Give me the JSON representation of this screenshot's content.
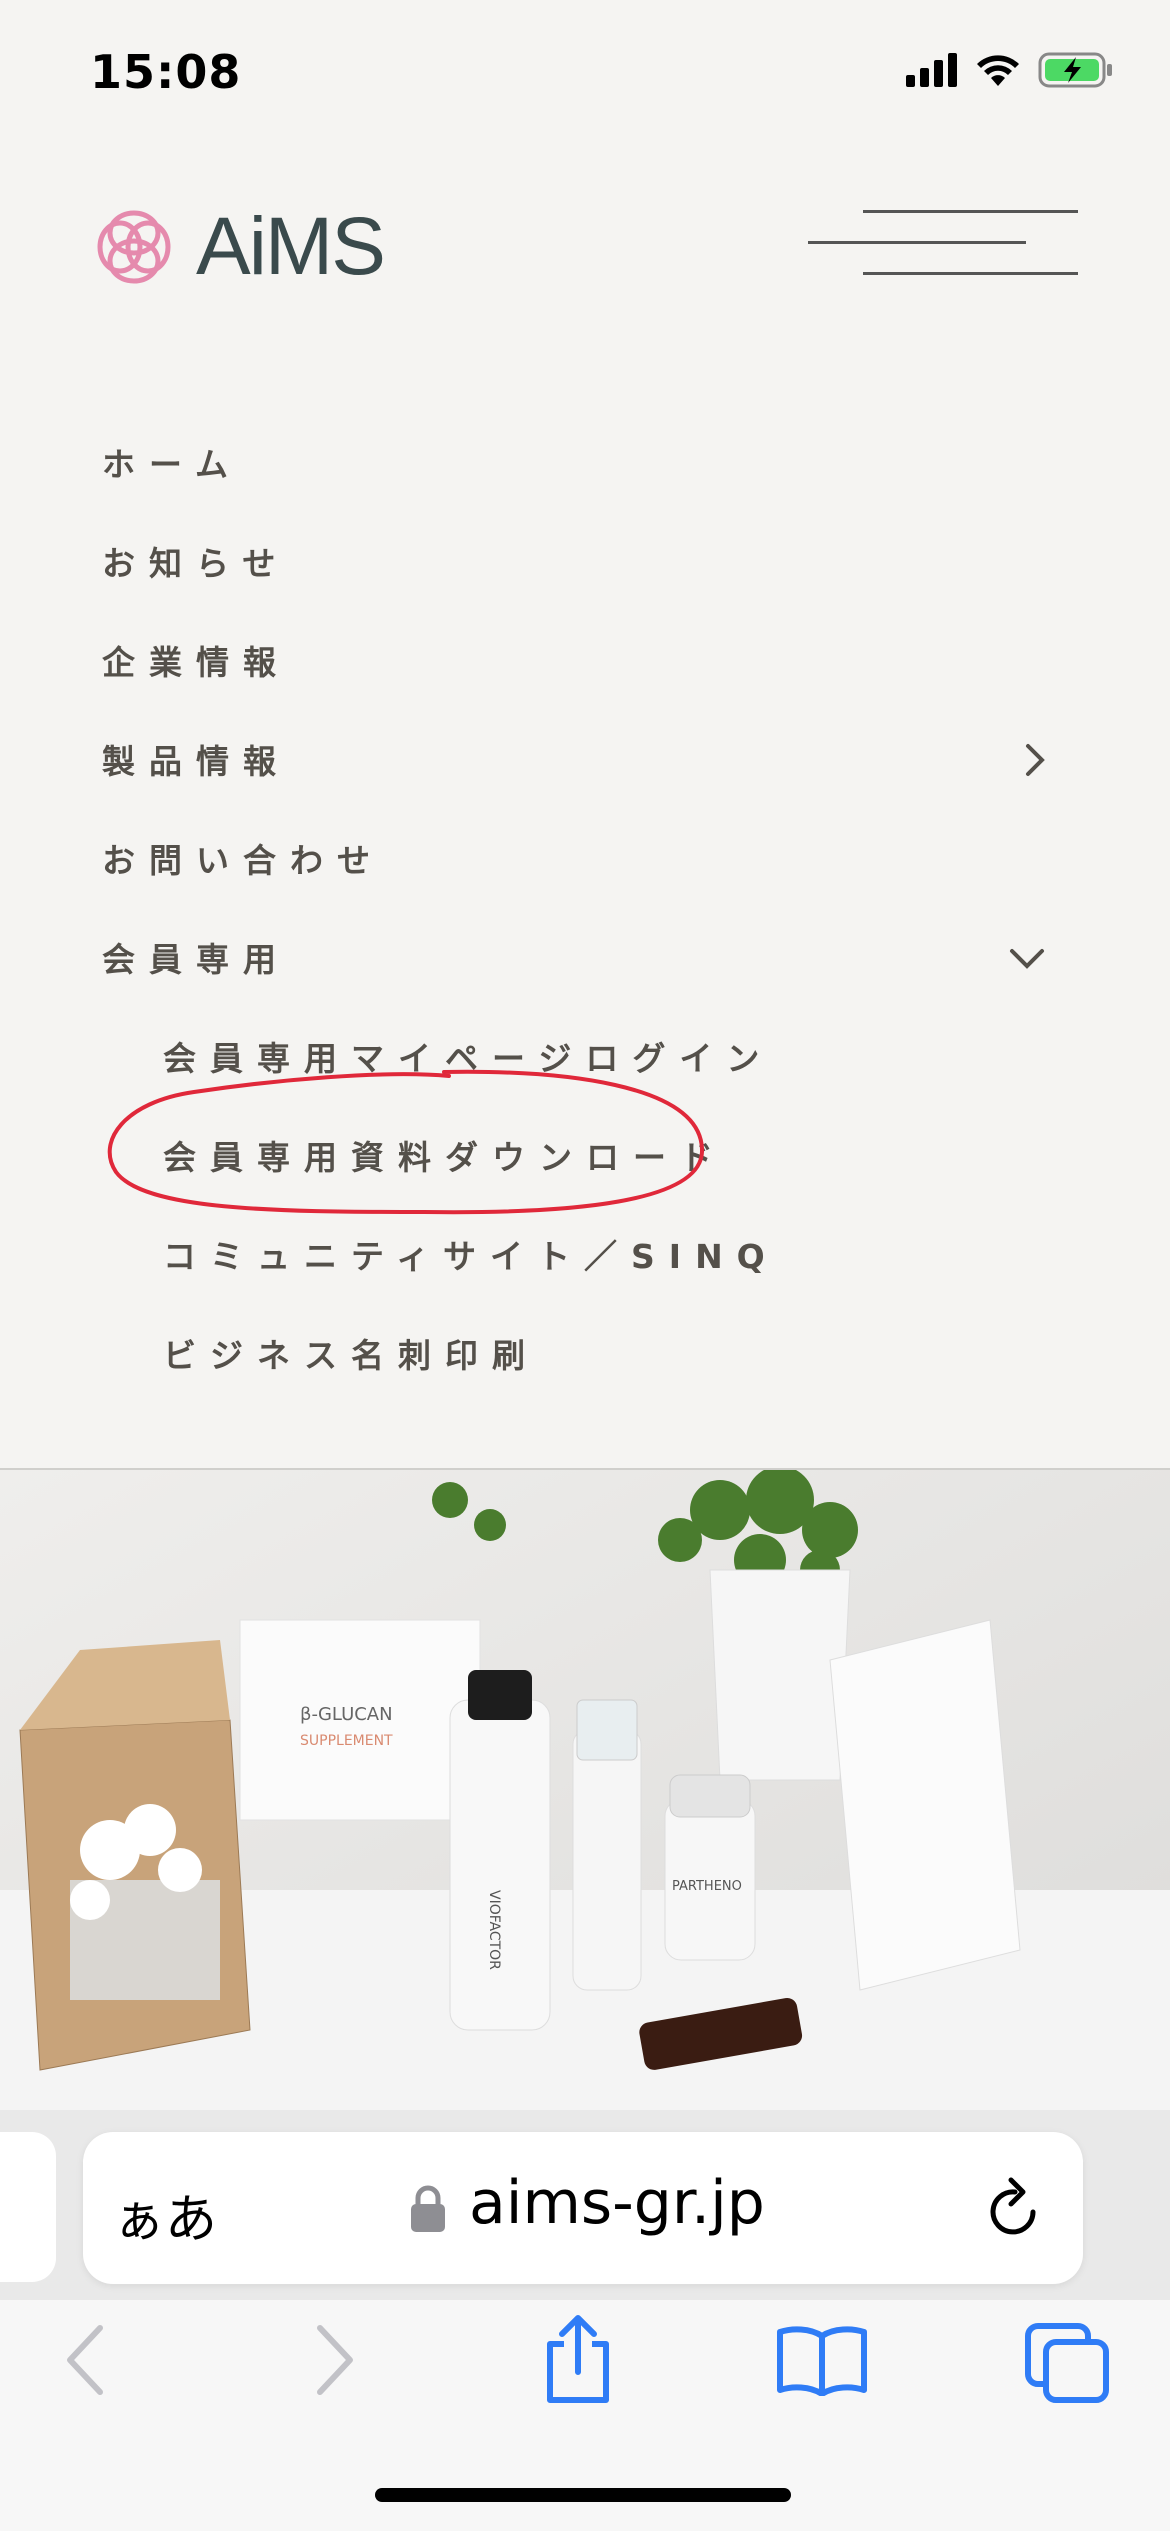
{
  "status_bar": {
    "time": "15:08"
  },
  "header": {
    "logo_text": "AiMS",
    "brand_color": "#e58aad",
    "logo_text_color": "#3a4a4c"
  },
  "menu": {
    "items": [
      {
        "label": "ホーム"
      },
      {
        "label": "お知らせ"
      },
      {
        "label": "企業情報"
      },
      {
        "label": "製品情報",
        "icon": "chevron-right-icon"
      },
      {
        "label": "お問い合わせ"
      },
      {
        "label": "会員専用",
        "icon": "chevron-down-icon"
      }
    ],
    "sub_items": [
      {
        "label": "会員専用マイページログイン"
      },
      {
        "label": "会員専用資料ダウンロード"
      },
      {
        "label": "コミュニティサイト／SINQ"
      },
      {
        "label": "ビジネス名刺印刷"
      }
    ],
    "text_color": "#54504a",
    "highlight_color": "#e0283a"
  },
  "hero": {
    "products": [
      {
        "label": "β-GLUCAN"
      },
      {
        "label": "SUPPLEMENT"
      },
      {
        "label": "VIOFACTOR"
      },
      {
        "label": "PARTHENO"
      }
    ]
  },
  "browser": {
    "aa_label": "ぁあ",
    "url": "aims-gr.jp",
    "toolbar_icons": [
      "back-icon",
      "forward-icon",
      "share-icon",
      "bookmarks-icon",
      "tabs-icon"
    ],
    "accent_color": "#2f7cf6"
  }
}
